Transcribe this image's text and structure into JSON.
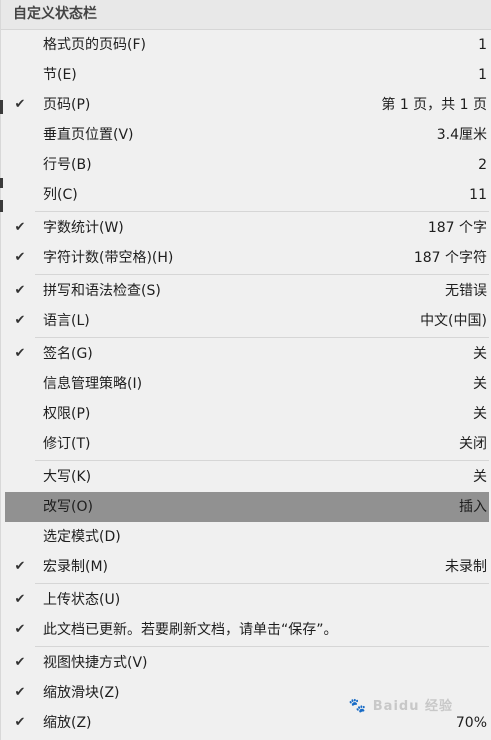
{
  "menu": {
    "title": "自定义状态栏",
    "groups": [
      [
        {
          "name": "format-page-number",
          "label": "格式页的页码(F)",
          "value": "1",
          "checked": false
        },
        {
          "name": "section",
          "label": "节(E)",
          "value": "1",
          "checked": false
        },
        {
          "name": "page-number",
          "label": "页码(P)",
          "value": "第 1 页，共 1 页",
          "checked": true
        },
        {
          "name": "vertical-position",
          "label": "垂直页位置(V)",
          "value": "3.4厘米",
          "checked": false
        },
        {
          "name": "line-number",
          "label": "行号(B)",
          "value": "2",
          "checked": false
        },
        {
          "name": "column",
          "label": "列(C)",
          "value": "11",
          "checked": false
        }
      ],
      [
        {
          "name": "word-count",
          "label": "字数统计(W)",
          "value": "187 个字",
          "checked": true
        },
        {
          "name": "character-count",
          "label": "字符计数(带空格)(H)",
          "value": "187 个字符",
          "checked": true
        }
      ],
      [
        {
          "name": "spelling-grammar",
          "label": "拼写和语法检查(S)",
          "value": "无错误",
          "checked": true
        },
        {
          "name": "language",
          "label": "语言(L)",
          "value": "中文(中国)",
          "checked": true
        }
      ],
      [
        {
          "name": "signatures",
          "label": "签名(G)",
          "value": "关",
          "checked": true
        },
        {
          "name": "info-management-policy",
          "label": "信息管理策略(I)",
          "value": "关",
          "checked": false
        },
        {
          "name": "permissions",
          "label": "权限(P)",
          "value": "关",
          "checked": false
        },
        {
          "name": "track-changes",
          "label": "修订(T)",
          "value": "关闭",
          "checked": false
        }
      ],
      [
        {
          "name": "caps-lock",
          "label": "大写(K)",
          "value": "关",
          "checked": false
        },
        {
          "name": "overtype",
          "label": "改写(O)",
          "value": "插入",
          "checked": false,
          "highlight": true
        },
        {
          "name": "selection-mode",
          "label": "选定模式(D)",
          "value": "",
          "checked": false
        },
        {
          "name": "macro-recording",
          "label": "宏录制(M)",
          "value": "未录制",
          "checked": true
        }
      ],
      [
        {
          "name": "upload-status",
          "label": "上传状态(U)",
          "value": "",
          "checked": true
        },
        {
          "name": "document-updated",
          "label": "此文档已更新。若要刷新文档，请单击“保存”。",
          "value": "",
          "checked": true
        }
      ],
      [
        {
          "name": "view-shortcuts",
          "label": "视图快捷方式(V)",
          "value": "",
          "checked": true
        },
        {
          "name": "zoom-slider",
          "label": "缩放滑块(Z)",
          "value": "",
          "checked": true
        },
        {
          "name": "zoom",
          "label": "缩放(Z)",
          "value": "70%",
          "checked": true
        }
      ]
    ],
    "check_glyph": "✔"
  },
  "watermark": {
    "text": "Baidu 经验",
    "icon": "paw-icon"
  },
  "colors": {
    "menu_bg": "#f0f0f0",
    "highlight_bg": "#919191",
    "separator": "#d6d6d6"
  }
}
